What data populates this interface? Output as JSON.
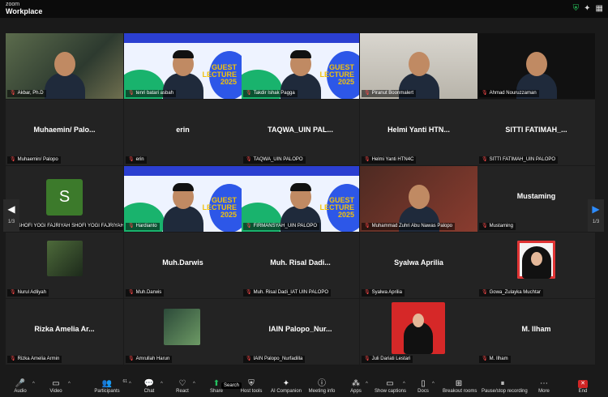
{
  "app": {
    "line1": "zoom",
    "line2": "Workplace"
  },
  "tiles": [
    {
      "type": "video",
      "style": "cam1",
      "name": "Akbar, Ph.D",
      "active": true
    },
    {
      "type": "lecture",
      "name": "tenri batari asbah"
    },
    {
      "type": "lecture",
      "name": "Takdir Ishak Pagga"
    },
    {
      "type": "video",
      "style": "room",
      "name": "Piranut Boonmalert"
    },
    {
      "type": "video",
      "style": "dark",
      "name": "Ahmad Nouruzzaman"
    },
    {
      "type": "text",
      "big": "Muhaemin/ Palo...",
      "name": "Muhaemin/ Palopo"
    },
    {
      "type": "text",
      "big": "erin",
      "name": "erin"
    },
    {
      "type": "text",
      "big": "TAQWA_UIN PAL...",
      "name": "TAQWA_UIN PALOPO"
    },
    {
      "type": "text",
      "big": "Helmi Yanti HTN...",
      "name": "Helmi Yanti HTN4C"
    },
    {
      "type": "text",
      "big": "SITTI FATIMAH_...",
      "name": "SITTI FATIMAH_UIN PALOPO"
    },
    {
      "type": "avatar",
      "letter": "S",
      "name": "SHOFI YOGI FAJRIYAH SHOFI YOGI FAJRIYAH"
    },
    {
      "type": "lecture",
      "name": "Hardianto"
    },
    {
      "type": "lecture",
      "name": "FIRMANSYAH_UIN PALOPO"
    },
    {
      "type": "video",
      "style": "red",
      "name": "Muhammad Zuhri Abu Nawas Palopo"
    },
    {
      "type": "text",
      "big": "Mustaming",
      "name": "Mustaming"
    },
    {
      "type": "photo",
      "photo": "p1",
      "name": "Nurul Adliyah"
    },
    {
      "type": "text",
      "big": "Muh.Darwis",
      "name": "Muh.Darwis"
    },
    {
      "type": "text",
      "big": "Muh. Risal Dadi...",
      "name": "Muh. Risal Dadi_IAT UIN PALOPO"
    },
    {
      "type": "text",
      "big": "Syalwa Aprilia",
      "name": "Syalwa Aprilia"
    },
    {
      "type": "photo",
      "photo": "p2",
      "name": "Gowa_Zulayka Muchtar"
    },
    {
      "type": "text",
      "big": "Rizka Amelia Ar...",
      "name": "Rizka Amelia Armin"
    },
    {
      "type": "photo",
      "photo": "p3",
      "name": "Amrullah Harun"
    },
    {
      "type": "text",
      "big": "IAIN Palopo_Nur...",
      "name": "IAIN Palopo_Nurfadilla"
    },
    {
      "type": "photo",
      "photo": "p4",
      "name": "Juli Dariati Lestari"
    },
    {
      "type": "text",
      "big": "M. Ilham",
      "name": "M. Ilham"
    }
  ],
  "lecture_text": {
    "l1": "GUEST",
    "l2": "LECTURE",
    "l3": "2025"
  },
  "nav": {
    "left_page": "1/3",
    "right_page": "1/3"
  },
  "toolbar": {
    "audio": "Audio",
    "video": "Video",
    "participants": "Participants",
    "participants_count": "61",
    "chat": "Chat",
    "react": "React",
    "share": "Share",
    "host_tools": "Host tools",
    "ai_companion": "AI Companion",
    "meeting_info": "Meeting info",
    "apps": "Apps",
    "show_captions": "Show captions",
    "docs": "Docs",
    "breakout_rooms": "Breakout rooms",
    "pause_recording": "Pause/stop recording",
    "more": "More",
    "end": "End",
    "tooltip": "Search"
  },
  "colors": {
    "active_border": "#2bd46a",
    "mic_muted": "#ff4a4a",
    "end": "#d02525",
    "share": "#24c160"
  }
}
